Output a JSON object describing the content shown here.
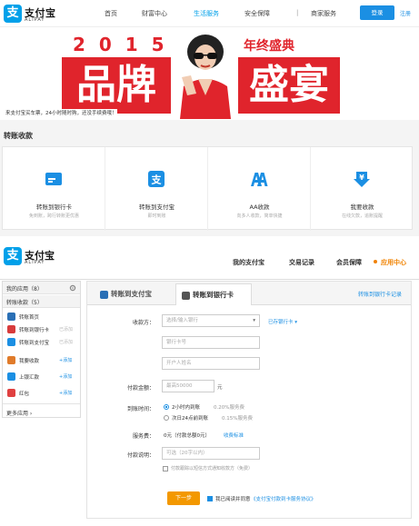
{
  "topnav": {
    "logo_glyph": "支",
    "logo_text": "支付宝",
    "logo_sub": "ALIPAY",
    "items": [
      "首页",
      "财富中心",
      "生活服务",
      "安全保障",
      "|",
      "商家服务"
    ],
    "login": "登录",
    "register": "注册"
  },
  "banner": {
    "year": "2 0 1 5",
    "year_label": "年终盛典",
    "big_left": "品牌",
    "big_right": "盛宴",
    "slogan": "来支付宝买车票，24小时随时购，还没手续费哦！"
  },
  "section": {
    "title": "转账收款",
    "cards": [
      {
        "title": "转账到银行卡",
        "sub": "免到账，跨行转账更优惠",
        "icon": "bank-card-icon"
      },
      {
        "title": "转账到支付宝",
        "sub": "即时到账",
        "icon": "alipay-transfer-icon"
      },
      {
        "title": "AA收款",
        "sub": "向多人收款，简单快捷",
        "icon": "aa-icon"
      },
      {
        "title": "我要收款",
        "sub": "在线欠款，追账提醒",
        "icon": "receive-money-icon"
      }
    ]
  },
  "header2": {
    "logo_glyph": "支",
    "logo_text": "支付宝",
    "logo_sub": "ALIPAY",
    "nav": [
      "我的支付宝",
      "交易记录",
      "会员保障",
      "应用中心"
    ]
  },
  "sidebar": {
    "my_apps": "我的应用（8）",
    "transfer_group": "转账收款（5）",
    "items": [
      {
        "label": "转账首页",
        "action": "",
        "color": "#2a6fb5"
      },
      {
        "label": "转账到银行卡",
        "action": "已添加",
        "color": "#d83b3b"
      },
      {
        "label": "转账到支付宝",
        "action": "已添加",
        "color": "#1b8fe3"
      },
      {
        "label": "我要收款",
        "action": "+添加",
        "color": "#e07b2a"
      },
      {
        "label": "上银汇款",
        "action": "+添加",
        "color": "#1b8fe3"
      },
      {
        "label": "红包",
        "action": "+添加",
        "color": "#e04040"
      }
    ],
    "more": "更多应用 ›"
  },
  "panel": {
    "tab1": "转账到支付宝",
    "tab2": "转账到银行卡",
    "tab_right": "转账到银行卡记录",
    "labels": {
      "receiver": "收款方：",
      "amount": "付款金额：",
      "arrival": "到账时间：",
      "fee": "服务费：",
      "note": "付款说明："
    },
    "bank_placeholder": "选择/输入银行",
    "bank_link": "已存银行卡 ▾",
    "card_placeholder": "银行卡号",
    "name_placeholder": "开户人姓名",
    "amount_placeholder": "最高50000",
    "amount_unit": "元",
    "arrival_opt1": "2小时内到账",
    "arrival_opt1_fee": "0.20%服务费",
    "arrival_opt2": "次日24点前到账",
    "arrival_opt2_fee": "0.15%服务费",
    "fee_text": "0元（付款总额0元）",
    "fee_link": "收费标准",
    "note_placeholder": "可选（20字以内）",
    "sms_text": "付款跟踪以短信方式通知收款方（免费）",
    "next": "下一步",
    "agree_text": "我已阅读并同意",
    "agree_link": "《支付宝付款到卡服务协议》"
  }
}
